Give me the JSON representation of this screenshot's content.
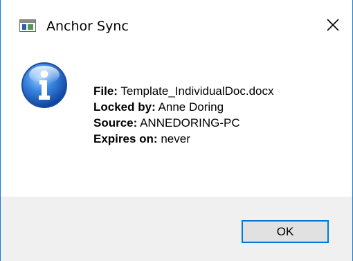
{
  "window": {
    "title": "Anchor Sync",
    "app_icon": "window-app-icon",
    "close_icon": "close-icon",
    "border_color": "#1979ca"
  },
  "message": {
    "icon": "info-icon",
    "rows": [
      {
        "label": "File:",
        "value": "Template_IndividualDoc.docx"
      },
      {
        "label": "Locked by:",
        "value": "Anne Doring"
      },
      {
        "label": "Source:",
        "value": "ANNEDORING-PC"
      },
      {
        "label": "Expires on:",
        "value": "never"
      }
    ]
  },
  "footer": {
    "ok_label": "OK",
    "button_focus_color": "#0078d7"
  }
}
